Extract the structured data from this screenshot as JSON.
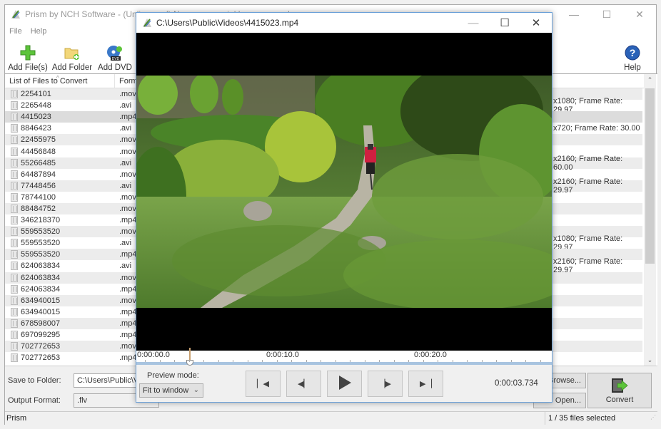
{
  "main_window": {
    "title": "Prism by NCH Software - (Unlicensed) Non-commercial home use only",
    "controls": {
      "minimize": "—",
      "maximize": "☐",
      "close": "✕"
    }
  },
  "menu": [
    {
      "label": "File"
    },
    {
      "label": "Help"
    }
  ],
  "toolbar": {
    "add_files": {
      "label": "Add File(s)",
      "icon": "green-plus-icon"
    },
    "add_folder": {
      "label": "Add Folder",
      "icon": "folder-add-icon"
    },
    "add_dvd": {
      "label": "Add DVD",
      "icon": "dvd-add-icon"
    },
    "help": {
      "label": "Help",
      "icon": "help-icon"
    }
  },
  "file_list": {
    "columns": [
      "List of Files to Convert",
      "Format"
    ],
    "rows": [
      {
        "name": "2254101",
        "format": ".mov",
        "info": ""
      },
      {
        "name": "2265448",
        "format": ".avi",
        "info": "x1080; Frame Rate: 29.97"
      },
      {
        "name": "4415023",
        "format": ".mp4",
        "info": "",
        "selected": true
      },
      {
        "name": "8846423",
        "format": ".avi",
        "info": "x720; Frame Rate: 30.00"
      },
      {
        "name": "22455975",
        "format": ".mov",
        "info": ""
      },
      {
        "name": "44456848",
        "format": ".mov",
        "info": ""
      },
      {
        "name": "55266485",
        "format": ".avi",
        "info": "x2160; Frame Rate: 60.00"
      },
      {
        "name": "64487894",
        "format": ".mov",
        "info": ""
      },
      {
        "name": "77448456",
        "format": ".avi",
        "info": "x2160; Frame Rate: 29.97"
      },
      {
        "name": "78744100",
        "format": ".mov",
        "info": ""
      },
      {
        "name": "88484752",
        "format": ".mov",
        "info": ""
      },
      {
        "name": "346218370",
        "format": ".mp4",
        "info": ""
      },
      {
        "name": "559553520",
        "format": ".mov",
        "info": ""
      },
      {
        "name": "559553520",
        "format": ".avi",
        "info": "x1080; Frame Rate: 29.97"
      },
      {
        "name": "559553520",
        "format": ".mp4",
        "info": ""
      },
      {
        "name": "624063834",
        "format": ".avi",
        "info": "x2160; Frame Rate: 29.97"
      },
      {
        "name": "624063834",
        "format": ".mov",
        "info": ""
      },
      {
        "name": "624063834",
        "format": ".mp4",
        "info": ""
      },
      {
        "name": "634940015",
        "format": ".mov",
        "info": ""
      },
      {
        "name": "634940015",
        "format": ".mp4",
        "info": ""
      },
      {
        "name": "678598007",
        "format": ".mp4",
        "info": ""
      },
      {
        "name": "697099295",
        "format": ".mp4",
        "info": ""
      },
      {
        "name": "702772653",
        "format": ".mov",
        "info": ""
      },
      {
        "name": "702772653",
        "format": ".mp4",
        "info": ""
      }
    ]
  },
  "bottom": {
    "save_to_label": "Save to Folder:",
    "save_to_value": "C:\\Users\\Public\\Videos",
    "output_format_label": "Output Format:",
    "output_format_value": ".flv",
    "browse_label": "Browse...",
    "open_label": "Open...",
    "convert_label": "Convert"
  },
  "status": {
    "left": "Prism",
    "right": "1 / 35 files selected"
  },
  "preview": {
    "title": "C:\\Users\\Public\\Videos\\4415023.mp4",
    "timeline": {
      "labels": [
        "0:00:00.0",
        "0:00:10.0",
        "0:00:20.0"
      ],
      "position": "0:00:03.734"
    },
    "preview_mode_label": "Preview mode:",
    "preview_mode_value": "Fit to window",
    "current_time": "0:00:03.734",
    "buttons": {
      "start": "go-to-start-icon",
      "prev_frame": "previous-frame-icon",
      "play": "play-icon",
      "next_frame": "next-frame-icon",
      "end": "go-to-end-icon"
    }
  }
}
